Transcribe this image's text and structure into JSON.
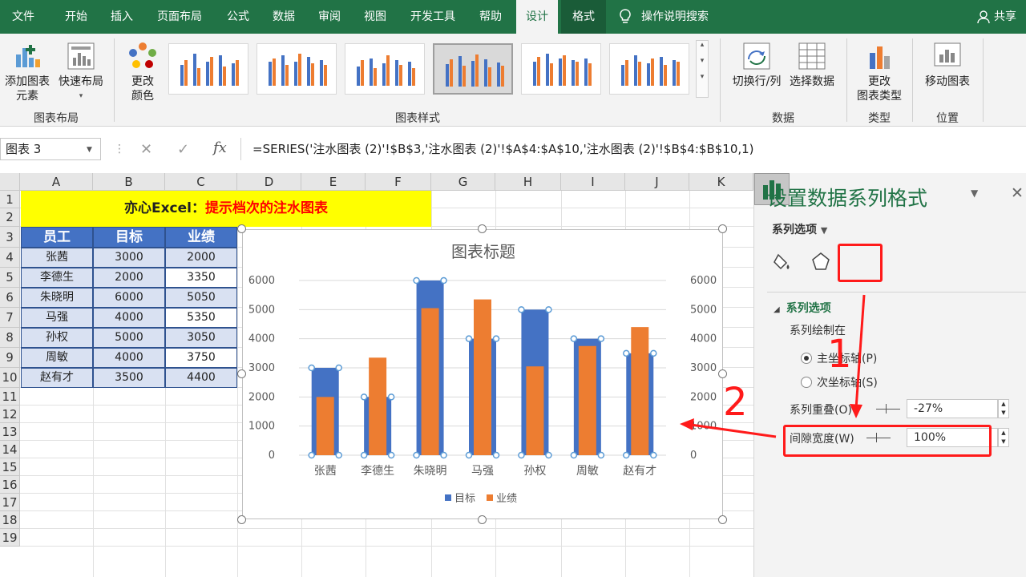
{
  "tabs": [
    "文件",
    "开始",
    "插入",
    "页面布局",
    "公式",
    "数据",
    "审阅",
    "视图",
    "开发工具",
    "帮助",
    "设计",
    "格式"
  ],
  "active_tab": "设计",
  "tell_me": "操作说明搜索",
  "share": "共享",
  "ribbon": {
    "add_element": "添加图表\n元素",
    "quick_layout": "快速布局",
    "change_color": "更改\n颜色",
    "group_layout": "图表布局",
    "group_styles": "图表样式",
    "switch_row_col": "切换行/列",
    "select_data": "选择数据",
    "group_data": "数据",
    "change_type": "更改\n图表类型",
    "group_type": "类型",
    "move_chart": "移动图表",
    "group_location": "位置"
  },
  "namebox": "图表 3",
  "formula": "=SERIES('注水图表 (2)'!$B$3,'注水图表 (2)'!$A$4:$A$10,'注水图表 (2)'!$B$4:$B$10,1)",
  "columns": [
    "A",
    "B",
    "C",
    "D",
    "E",
    "F",
    "G",
    "H",
    "I",
    "J",
    "K"
  ],
  "rows": [
    "1",
    "2",
    "3",
    "4",
    "5",
    "6",
    "7",
    "8",
    "9",
    "10",
    "11",
    "12",
    "13",
    "14",
    "15",
    "16",
    "17",
    "18",
    "19"
  ],
  "banner": {
    "black": "亦心Excel：",
    "red": "提示档次的注水图表"
  },
  "table": {
    "headers": [
      "员工",
      "目标",
      "业绩"
    ],
    "rows": [
      [
        "张茜",
        "3000",
        "2000"
      ],
      [
        "李德生",
        "2000",
        "3350"
      ],
      [
        "朱晓明",
        "6000",
        "5050"
      ],
      [
        "马强",
        "4000",
        "5350"
      ],
      [
        "孙权",
        "5000",
        "3050"
      ],
      [
        "周敏",
        "4000",
        "3750"
      ],
      [
        "赵有才",
        "3500",
        "4400"
      ]
    ]
  },
  "chart_data": {
    "type": "bar",
    "title": "图表标题",
    "categories": [
      "张茜",
      "李德生",
      "朱晓明",
      "马强",
      "孙权",
      "周敏",
      "赵有才"
    ],
    "series": [
      {
        "name": "目标",
        "values": [
          3000,
          2000,
          6000,
          4000,
          5000,
          4000,
          3500
        ],
        "color": "#4472c4",
        "axis": "primary"
      },
      {
        "name": "业绩",
        "values": [
          2000,
          3350,
          5050,
          5350,
          3050,
          3750,
          4400
        ],
        "color": "#ed7d31",
        "axis": "secondary"
      }
    ],
    "ylim": [
      0,
      6000
    ],
    "yticks": [
      "6000",
      "5000",
      "4000",
      "3000",
      "2000",
      "1000",
      "0"
    ],
    "legend": "bottom",
    "grid": true
  },
  "pane": {
    "title": "设置数据系列格式",
    "series_options_dd": "系列选项",
    "section": "系列选项",
    "plot_on": "系列绘制在",
    "primary": "主坐标轴(P)",
    "secondary": "次坐标轴(S)",
    "overlap_label": "系列重叠(O)",
    "overlap_value": "-27%",
    "gap_label": "间隙宽度(W)",
    "gap_value": "100%"
  },
  "annotations": {
    "one": "1",
    "two": "2",
    "color": "#ff1a1a"
  }
}
